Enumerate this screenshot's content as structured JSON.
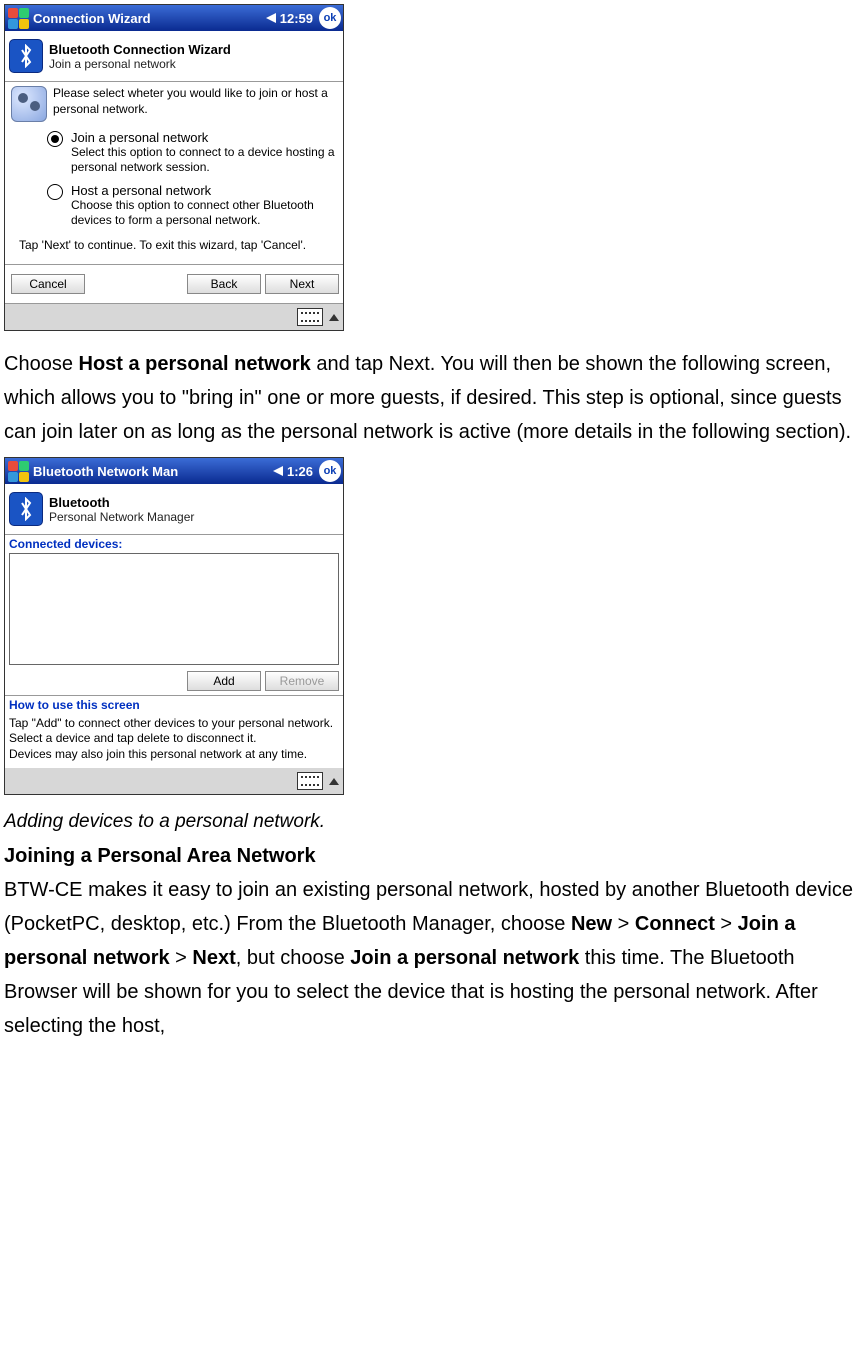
{
  "screenshot1": {
    "titlebar": {
      "title": "Connection Wizard",
      "time": "12:59",
      "ok": "ok"
    },
    "header": {
      "title": "Bluetooth Connection Wizard",
      "subtitle": "Join a personal network"
    },
    "prompt": "Please select wheter you would like to join or host a personal network.",
    "option1": {
      "label": "Join a personal network",
      "desc": "Select this option to connect to a device hosting a personal network session."
    },
    "option2": {
      "label": "Host a personal network",
      "desc": "Choose this option to connect other Bluetooth devices to form a personal network."
    },
    "hint": "Tap 'Next' to continue. To exit this wizard, tap 'Cancel'.",
    "buttons": {
      "cancel": "Cancel",
      "back": "Back",
      "next": "Next"
    }
  },
  "para1": {
    "t1": "Choose ",
    "b1": "Host a personal network",
    "t2": " and tap Next. You will then be shown the following screen, which allows you to \"bring in\" one or more guests, if desired. This step is optional, since guests can join later on as long as the personal network is active (more details in the following section)."
  },
  "screenshot2": {
    "titlebar": {
      "title": "Bluetooth Network Man",
      "time": "1:26",
      "ok": "ok"
    },
    "header": {
      "title": "Bluetooth",
      "subtitle": "Personal Network Manager"
    },
    "connected_label": "Connected devices:",
    "buttons": {
      "add": "Add",
      "remove": "Remove"
    },
    "how_title": "How to use this screen",
    "how_text": "Tap \"Add\" to connect other devices to your personal network. Select a device and tap delete to disconnect it.\nDevices may also join this personal network at any time."
  },
  "caption": "Adding devices to a personal network.",
  "heading": "Joining a Personal Area Network",
  "para2": {
    "t1": "BTW-CE makes it easy to join an existing personal network, hosted by another Bluetooth device (PocketPC, desktop, etc.) From the Bluetooth Manager, choose ",
    "b1": "New",
    "s1": " > ",
    "b2": "Connect",
    "s2": " > ",
    "b3": "Join a personal network",
    "s3": " > ",
    "b4": "Next",
    "t2": ", but choose ",
    "b5": "Join a personal network",
    "t3": " this time. The Bluetooth Browser will be shown for you to select the device that is hosting the personal network. After selecting the host,"
  }
}
